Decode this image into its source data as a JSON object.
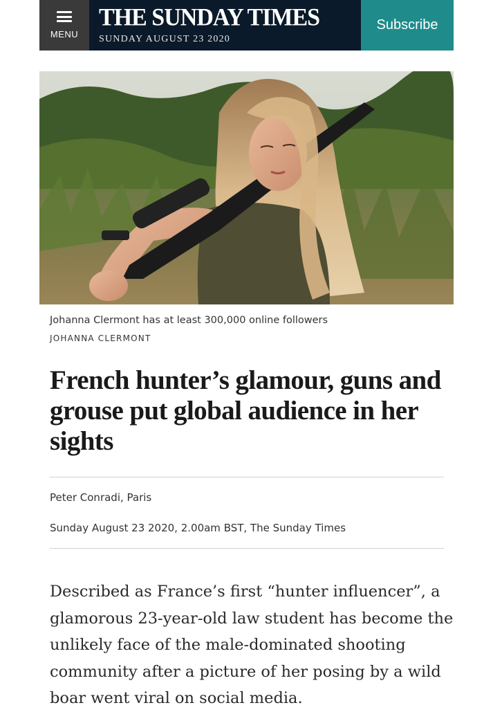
{
  "header": {
    "menu_label": "MENU",
    "title": "THE SUNDAY TIMES",
    "date": "SUNDAY AUGUST 23 2020",
    "subscribe_label": "Subscribe"
  },
  "image": {
    "caption": "Johanna Clermont has at least 300,000 online followers",
    "credit": "JOHANNA CLERMONT"
  },
  "article": {
    "headline": "French hunter’s glamour, guns and grouse put global audience in her sights",
    "byline": "Peter Conradi, Paris",
    "dateline": "Sunday August 23 2020, 2.00am BST, The Sunday Times",
    "body": "Described as France’s first “hunter influencer”, a glamorous 23-year-old law student has become the unlikely face of the male-dominated shooting community after a picture of her posing by a wild boar went viral on social media."
  },
  "colors": {
    "masthead_bg": "#0b1a2a",
    "menu_bg": "#3a3a3a",
    "subscribe_bg": "#1f8b8b"
  }
}
